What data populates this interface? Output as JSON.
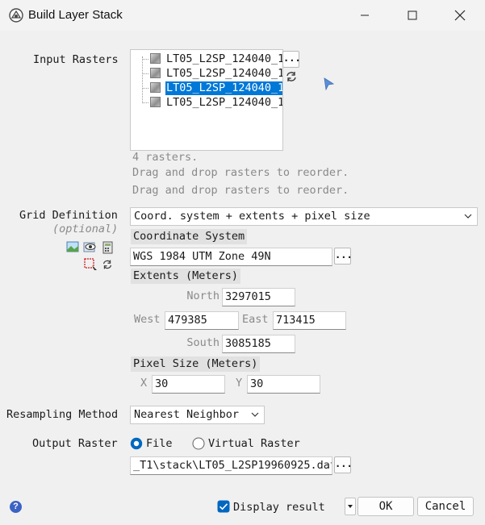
{
  "window": {
    "title": "Build Layer Stack"
  },
  "input_rasters": {
    "label": "Input Rasters",
    "items": [
      {
        "name": "LT05_L2SP_124040_1",
        "selected": false
      },
      {
        "name": "LT05_L2SP_124040_1",
        "selected": false
      },
      {
        "name": "LT05_L2SP_124040_1",
        "selected": true
      },
      {
        "name": "LT05_L2SP_124040_1",
        "selected": false
      }
    ],
    "browse_label": "...",
    "count_text": "4 rasters.",
    "hint_1": "Drag and drop rasters to reorder.",
    "hint_2": "Drag and drop rasters to reorder."
  },
  "grid": {
    "label": "Grid Definition",
    "optional": "(optional)",
    "mode": "Coord. system + extents + pixel size",
    "coord_header": "Coordinate System",
    "coord_value": "WGS 1984 UTM Zone 49N",
    "coord_browse": "...",
    "extents_header": "Extents (Meters)",
    "north_label": "North",
    "north": "3297015",
    "west_label": "West",
    "west": "479385",
    "east_label": "East",
    "east": "713415",
    "south_label": "South",
    "south": "3085185",
    "pixel_header": "Pixel Size (Meters)",
    "x_label": "X",
    "x": "30",
    "y_label": "Y",
    "y": "30"
  },
  "resampling": {
    "label": "Resampling Method",
    "value": "Nearest Neighbor"
  },
  "output": {
    "label": "Output Raster",
    "file_label": "File",
    "virtual_label": "Virtual Raster",
    "mode": "File",
    "path": "_T1\\stack\\LT05_L2SP19960925.dat",
    "browse": "..."
  },
  "footer": {
    "help": "?",
    "display_result_label": "Display result",
    "display_result": true,
    "ok": "OK",
    "cancel": "Cancel"
  },
  "colors": {
    "accent": "#0078d7",
    "window_bg": "#f0f0f0"
  }
}
